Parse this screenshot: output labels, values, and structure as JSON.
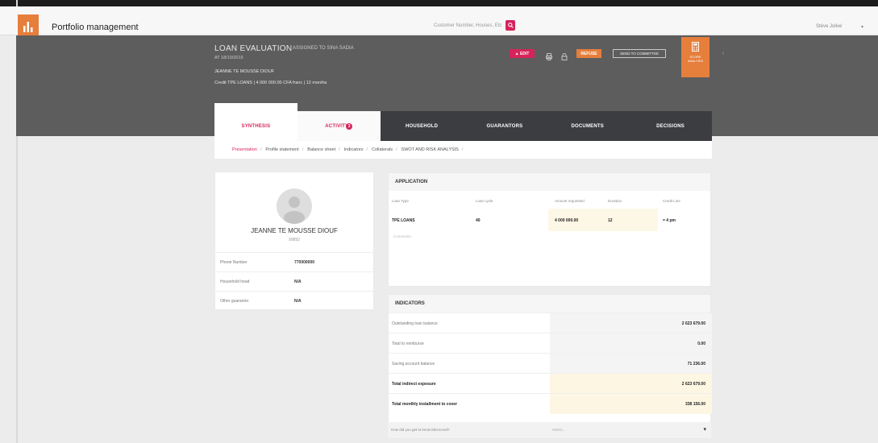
{
  "app": {
    "title": "Portfolio management",
    "search_placeholder": "Customer Number, Houses, Etc",
    "user": "Stéve Jolivé",
    "user_chevron": "▾"
  },
  "loan": {
    "title": "LOAN EVALUATION",
    "assigned": "| ASSIGNED TO SINA SADIA",
    "date": "AT 18/10/2019",
    "client": "JEANNE TE MOUSSE DIOUF",
    "summary": "Credit TPE LOANS | 4 000 000.00 CFA franc | 12 months"
  },
  "actions": {
    "edit": "▲ EDIT",
    "refuse": "REFUSE",
    "committee": "SEND TO COMMITTEE",
    "tile_caption": "SCORE\nANALYSIS",
    "tile_caret": "‹"
  },
  "tabs": [
    {
      "label": "SYNTHESIS"
    },
    {
      "label": "ACTIVITY"
    },
    {
      "label": "HOUSEHOLD"
    },
    {
      "label": "GUARANTORS"
    },
    {
      "label": "DOCUMENTS"
    },
    {
      "label": "DECISIONS"
    }
  ],
  "activity_badge": "3",
  "breadcrumbs": [
    "Presentation",
    "Profile statement",
    "Balance sheet",
    "Indicators",
    "Collaterals",
    "SWOT AND RISK ANALYSIS"
  ],
  "client_card": {
    "name": "JEANNE TE MOUSSE DIOUF",
    "sub": "99892",
    "rows": [
      {
        "k": "Phone Number",
        "v": "770000000"
      },
      {
        "k": "Household head",
        "v": "N/A"
      },
      {
        "k": "Other guarantor",
        "v": "N/A"
      }
    ]
  },
  "application": {
    "title": "APPLICATION",
    "columns": [
      "Loan Type",
      "Loan cycle",
      "Amount requested",
      "Duration",
      "Credit Line"
    ],
    "values": [
      "TPE LOANS",
      "40",
      "4 000 000.00",
      "12",
      "= 4 pm"
    ],
    "comment_placeholder": "Comments"
  },
  "indicators": {
    "title": "INDICATORS",
    "rows": [
      {
        "k": "Outstanding loan balance",
        "v": "2 623 679.00",
        "total": false
      },
      {
        "k": "Total to reimburse",
        "v": "0.00",
        "total": false
      },
      {
        "k": "Saving account balance",
        "v": "71 236.00",
        "total": false
      },
      {
        "k": "Total indirect exposure",
        "v": "2 623 679.00",
        "total": true
      },
      {
        "k": "Total monthly installment to cover",
        "v": "338 156.00",
        "total": true
      }
    ]
  },
  "question": {
    "label": "How did you get to know Microcred?",
    "select": "Select...",
    "caret": "▾"
  },
  "colors": {
    "accent": "#d6245b",
    "orange": "#e67e3c",
    "header_band": "#5d5d5d",
    "tabs_bg": "#3b3d40"
  }
}
